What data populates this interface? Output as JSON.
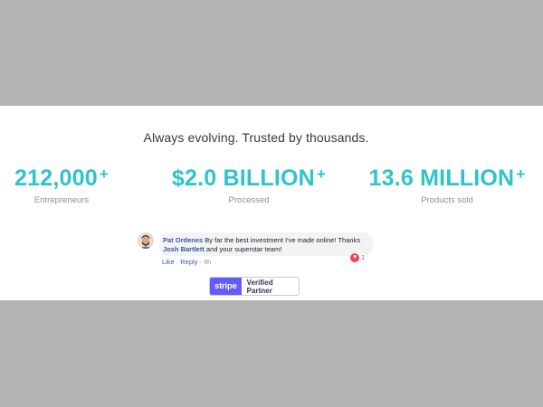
{
  "headline": "Always evolving.  Trusted by thousands.",
  "stats": [
    {
      "value": "212,000",
      "suffix": "+",
      "label": "Entrepreneurs"
    },
    {
      "value": "$2.0 BILLION",
      "suffix": "+",
      "label": "Processed"
    },
    {
      "value": "13.6 MILLION",
      "suffix": "+",
      "label": "Products sold"
    }
  ],
  "comment": {
    "author": "Pat Ordenes",
    "text_before": " By far the best investment I've made online! Thanks ",
    "mention": "Josh Bartlett",
    "text_after": " and your superstar team!",
    "reaction_count": "1",
    "actions": {
      "like": "Like",
      "reply": "Reply",
      "time": "9h"
    }
  },
  "badge": {
    "logo": "stripe",
    "label": "Verified Partner"
  },
  "colors": {
    "accent": "#2ec4c9",
    "stripe": "#635bff",
    "background": "#b3b3b3",
    "reaction": "#f33e58"
  },
  "icons": {
    "avatar": "user-avatar",
    "reaction": "heart-icon"
  }
}
